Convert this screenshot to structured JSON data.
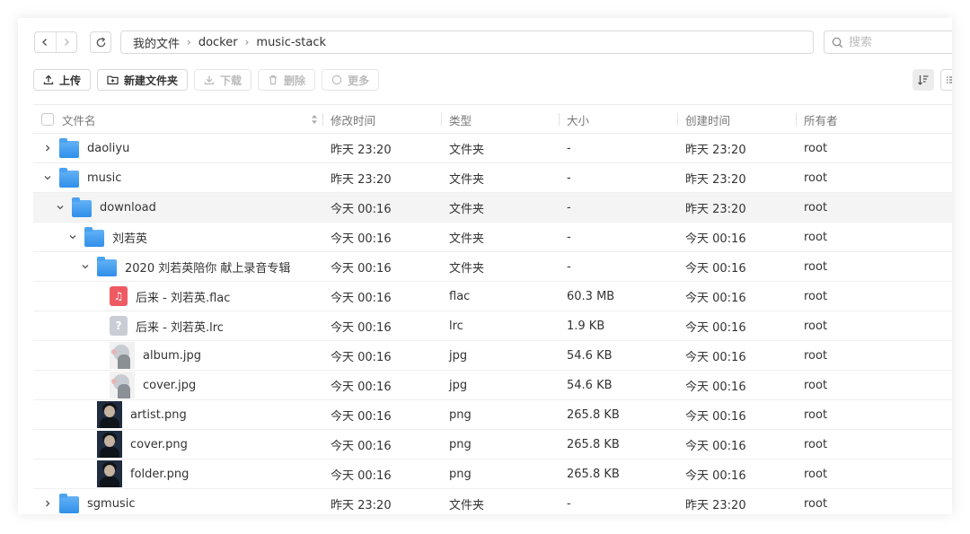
{
  "nav": {
    "back_icon": "chevron-left-icon",
    "forward_icon": "chevron-right-icon",
    "refresh_icon": "refresh-icon",
    "breadcrumb": [
      "我的文件",
      "docker",
      "music-stack"
    ],
    "search_placeholder": "搜索"
  },
  "toolbar": {
    "upload": "上传",
    "new_folder": "新建文件夹",
    "download": "下载",
    "delete": "删除",
    "more": "更多"
  },
  "columns": {
    "name": "文件名",
    "modified": "修改时间",
    "type": "类型",
    "size": "大小",
    "created": "创建时间",
    "owner": "所有者"
  },
  "rows": [
    {
      "name": "daoliyu",
      "icon": "folder",
      "depth": 0,
      "expand": "collapsed",
      "modified": "昨天 23:20",
      "type": "文件夹",
      "size": "-",
      "created": "昨天 23:20",
      "owner": "root"
    },
    {
      "name": "music",
      "icon": "folder",
      "depth": 0,
      "expand": "expanded",
      "modified": "昨天 23:20",
      "type": "文件夹",
      "size": "-",
      "created": "昨天 23:20",
      "owner": "root"
    },
    {
      "name": "download",
      "icon": "folder",
      "depth": 1,
      "expand": "expanded",
      "modified": "今天 00:16",
      "type": "文件夹",
      "size": "-",
      "created": "昨天 23:20",
      "owner": "root",
      "highlight": true
    },
    {
      "name": "刘若英",
      "icon": "folder",
      "depth": 2,
      "expand": "expanded",
      "modified": "今天 00:16",
      "type": "文件夹",
      "size": "-",
      "created": "今天 00:16",
      "owner": "root"
    },
    {
      "name": "2020 刘若英陪你 献上录音专辑",
      "icon": "folder",
      "depth": 3,
      "expand": "expanded",
      "modified": "今天 00:16",
      "type": "文件夹",
      "size": "-",
      "created": "今天 00:16",
      "owner": "root"
    },
    {
      "name": "后来 - 刘若英.flac",
      "icon": "flac",
      "depth": 4,
      "expand": "none",
      "modified": "今天 00:16",
      "type": "flac",
      "size": "60.3 MB",
      "created": "今天 00:16",
      "owner": "root"
    },
    {
      "name": "后来 - 刘若英.lrc",
      "icon": "lrc",
      "depth": 4,
      "expand": "none",
      "modified": "今天 00:16",
      "type": "lrc",
      "size": "1.9 KB",
      "created": "今天 00:16",
      "owner": "root"
    },
    {
      "name": "album.jpg",
      "icon": "jpg",
      "depth": 4,
      "expand": "none",
      "modified": "今天 00:16",
      "type": "jpg",
      "size": "54.6 KB",
      "created": "今天 00:16",
      "owner": "root"
    },
    {
      "name": "cover.jpg",
      "icon": "jpg",
      "depth": 4,
      "expand": "none",
      "modified": "今天 00:16",
      "type": "jpg",
      "size": "54.6 KB",
      "created": "今天 00:16",
      "owner": "root"
    },
    {
      "name": "artist.png",
      "icon": "png",
      "depth": 3,
      "expand": "none",
      "modified": "今天 00:16",
      "type": "png",
      "size": "265.8 KB",
      "created": "今天 00:16",
      "owner": "root"
    },
    {
      "name": "cover.png",
      "icon": "png",
      "depth": 3,
      "expand": "none",
      "modified": "今天 00:16",
      "type": "png",
      "size": "265.8 KB",
      "created": "今天 00:16",
      "owner": "root"
    },
    {
      "name": "folder.png",
      "icon": "png",
      "depth": 3,
      "expand": "none",
      "modified": "今天 00:16",
      "type": "png",
      "size": "265.8 KB",
      "created": "今天 00:16",
      "owner": "root"
    },
    {
      "name": "sgmusic",
      "icon": "folder",
      "depth": 0,
      "expand": "collapsed",
      "modified": "昨天 23:20",
      "type": "文件夹",
      "size": "-",
      "created": "昨天 23:20",
      "owner": "root"
    }
  ]
}
